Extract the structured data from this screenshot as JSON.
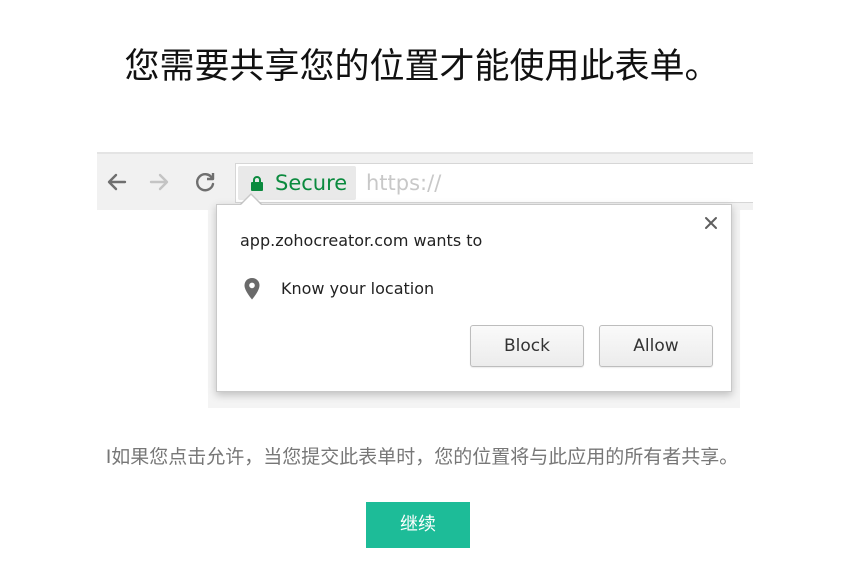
{
  "heading": "您需要共享您的位置才能使用此表单。",
  "browser": {
    "secure_label": "Secure",
    "url_text": "https://",
    "permission_prompt": {
      "origin_text": "app.zohocreator.com wants to",
      "permission_text": "Know your location",
      "block_label": "Block",
      "allow_label": "Allow"
    }
  },
  "info_text": "I如果您点击允许，当您提交此表单时，您的位置将与此应用的所有者共享。",
  "continue_label": "继续",
  "colors": {
    "secure_green": "#0b8a3e",
    "continue_button": "#1dbc98"
  }
}
